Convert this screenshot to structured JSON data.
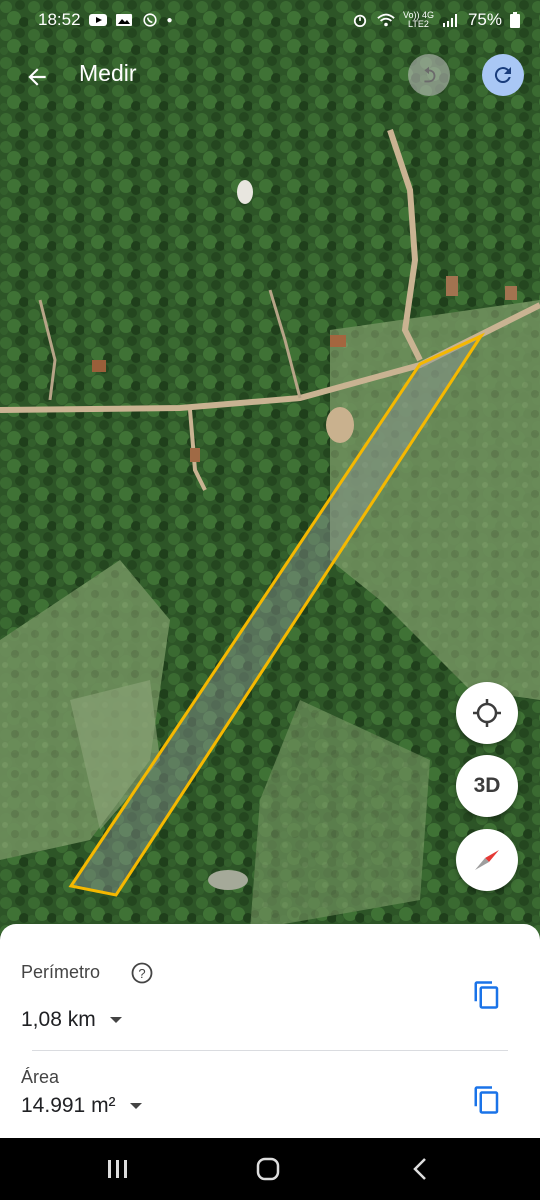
{
  "status_bar": {
    "time": "18:52",
    "notification_icons": [
      "youtube-icon",
      "gallery-icon",
      "whatsapp-icon",
      "dot-icon"
    ],
    "network_top": "Vo)) 4G",
    "network_bottom": "LTE2",
    "battery": "75%"
  },
  "top_bar": {
    "title": "Medir",
    "back_icon": "arrow-back-icon",
    "undo_icon": "undo-icon",
    "redo_icon": "redo-icon"
  },
  "map_controls": {
    "locate_icon": "my-location-icon",
    "three_d_label": "3D",
    "compass_icon": "compass-icon"
  },
  "measurement": {
    "perimeter_label": "Perímetro",
    "perimeter_value": "1,08 km",
    "area_label": "Área",
    "area_value": "14.991 m²"
  },
  "colors": {
    "polygon_outline": "#f5b800",
    "redo_button_bg": "#a9c7f5",
    "copy_icon": "#1a73e8"
  },
  "nav_bar": {
    "recent_icon": "recent-apps-icon",
    "home_icon": "home-icon",
    "back_icon": "nav-back-icon"
  }
}
